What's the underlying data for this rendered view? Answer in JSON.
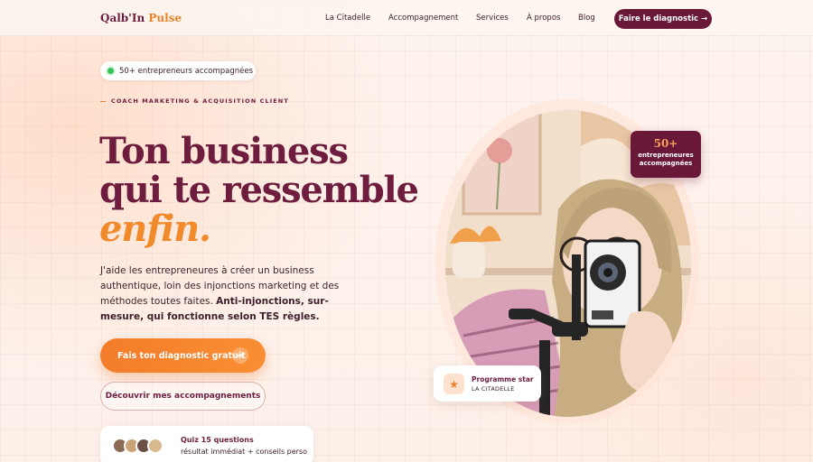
{
  "brand": {
    "name_main": "Qalb'In",
    "name_accent": " Pulse"
  },
  "nav": {
    "links": [
      "La Citadelle",
      "Accompagnement",
      "Services",
      "À propos",
      "Blog"
    ],
    "cta": "Faire le diagnostic →"
  },
  "hero": {
    "pill": "50+ entrepreneurs accompagnées",
    "eyebrow": "COACH MARKETING & ACQUISITION CLIENT",
    "title_line1": "Ton business",
    "title_line2": "qui te ressemble",
    "title_em": "enfin.",
    "lead_plain": "J'aide les entrepreneures à créer un business authentique, loin des injonctions marketing et des méthodes toutes faites. ",
    "lead_bold": "Anti-injonctions, sur-mesure, qui fonctionne selon TES règles.",
    "primary_cta": "Fais ton diagnostic gratuit",
    "primary_cta_arrow": "→",
    "secondary_cta": "Découvrir mes accompagnements",
    "quiz_title": "Quiz 15 questions",
    "quiz_subtitle": "résultat immédiat + conseils perso"
  },
  "stat_badge": {
    "number": "50+",
    "label": "entrepreneures accompagnées"
  },
  "program_card": {
    "title": "Programme star",
    "subtitle": "LA CITADELLE",
    "icon": "star-icon"
  },
  "colors": {
    "brand": "#6a1838",
    "accent": "#f37c2a",
    "status": "#36c15a"
  }
}
